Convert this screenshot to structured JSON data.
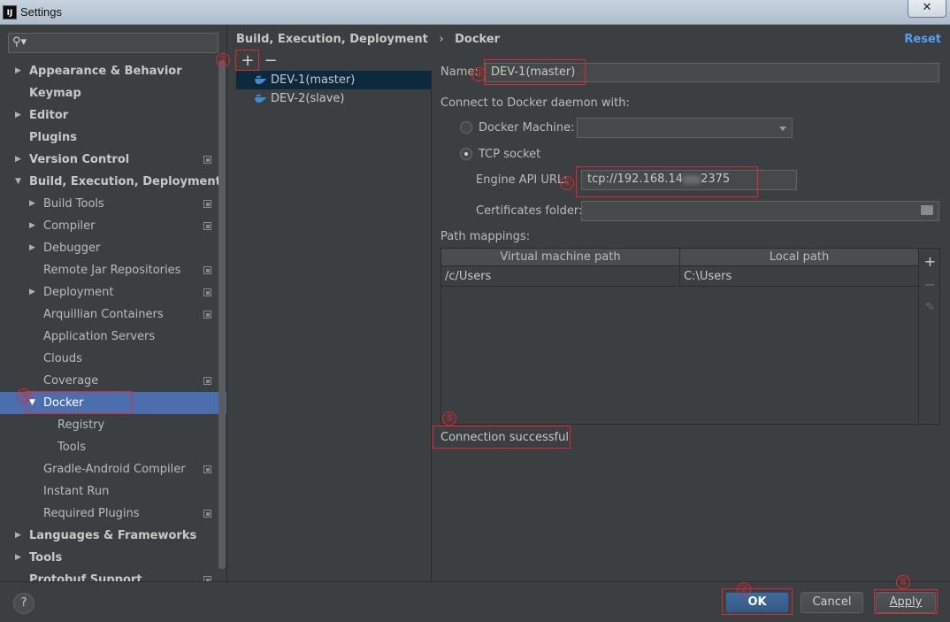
{
  "window": {
    "title": "Settings",
    "app_icon": "IJ",
    "close_icon": "✕"
  },
  "search": {
    "placeholder": "",
    "icon": "search-icon"
  },
  "tree": [
    {
      "label": "Appearance & Behavior",
      "level": 0,
      "bold": true,
      "expandable": true,
      "expanded": false,
      "project_icon": false
    },
    {
      "label": "Keymap",
      "level": 0,
      "bold": true,
      "expandable": false,
      "project_icon": false
    },
    {
      "label": "Editor",
      "level": 0,
      "bold": true,
      "expandable": true,
      "expanded": false,
      "project_icon": false
    },
    {
      "label": "Plugins",
      "level": 0,
      "bold": true,
      "expandable": false,
      "project_icon": false
    },
    {
      "label": "Version Control",
      "level": 0,
      "bold": true,
      "expandable": true,
      "expanded": false,
      "project_icon": true
    },
    {
      "label": "Build, Execution, Deployment",
      "level": 0,
      "bold": true,
      "expandable": true,
      "expanded": true,
      "project_icon": false
    },
    {
      "label": "Build Tools",
      "level": 1,
      "bold": false,
      "expandable": true,
      "expanded": false,
      "project_icon": true
    },
    {
      "label": "Compiler",
      "level": 1,
      "bold": false,
      "expandable": true,
      "expanded": false,
      "project_icon": true
    },
    {
      "label": "Debugger",
      "level": 1,
      "bold": false,
      "expandable": true,
      "expanded": false,
      "project_icon": false
    },
    {
      "label": "Remote Jar Repositories",
      "level": 1,
      "bold": false,
      "expandable": false,
      "project_icon": true
    },
    {
      "label": "Deployment",
      "level": 1,
      "bold": false,
      "expandable": true,
      "expanded": false,
      "project_icon": true
    },
    {
      "label": "Arquillian Containers",
      "level": 1,
      "bold": false,
      "expandable": false,
      "project_icon": true
    },
    {
      "label": "Application Servers",
      "level": 1,
      "bold": false,
      "expandable": false,
      "project_icon": false
    },
    {
      "label": "Clouds",
      "level": 1,
      "bold": false,
      "expandable": false,
      "project_icon": false
    },
    {
      "label": "Coverage",
      "level": 1,
      "bold": false,
      "expandable": false,
      "project_icon": true
    },
    {
      "label": "Docker",
      "level": 1,
      "bold": false,
      "expandable": true,
      "expanded": true,
      "project_icon": false,
      "selected": true
    },
    {
      "label": "Registry",
      "level": 2,
      "bold": false,
      "expandable": false,
      "project_icon": false
    },
    {
      "label": "Tools",
      "level": 2,
      "bold": false,
      "expandable": false,
      "project_icon": false
    },
    {
      "label": "Gradle-Android Compiler",
      "level": 1,
      "bold": false,
      "expandable": false,
      "project_icon": true
    },
    {
      "label": "Instant Run",
      "level": 1,
      "bold": false,
      "expandable": false,
      "project_icon": false
    },
    {
      "label": "Required Plugins",
      "level": 1,
      "bold": false,
      "expandable": false,
      "project_icon": true
    },
    {
      "label": "Languages & Frameworks",
      "level": 0,
      "bold": true,
      "expandable": true,
      "expanded": false,
      "project_icon": false
    },
    {
      "label": "Tools",
      "level": 0,
      "bold": true,
      "expandable": true,
      "expanded": false,
      "project_icon": false
    },
    {
      "label": "Protobuf Support",
      "level": 0,
      "bold": true,
      "expandable": false,
      "project_icon": true
    }
  ],
  "breadcrumb": {
    "parent": "Build, Execution, Deployment",
    "separator": "›",
    "current": "Docker"
  },
  "reset_label": "Reset",
  "toolbar": {
    "add": "+",
    "remove": "−"
  },
  "docker_configs": [
    {
      "name": "DEV-1(master)",
      "selected": true
    },
    {
      "name": "DEV-2(slave)",
      "selected": false
    }
  ],
  "form": {
    "name_label": "Name:",
    "name_value": "DEV-1(master)",
    "connect_label": "Connect to Docker daemon with:",
    "docker_machine_label": "Docker Machine:",
    "docker_machine_value": "",
    "tcp_label": "TCP socket",
    "engine_label": "Engine API URL:",
    "engine_value": "tcp://192.168.14",
    "engine_value_tail": "2375",
    "cert_label": "Certificates folder:",
    "cert_value": "",
    "path_label": "Path mappings:"
  },
  "path_table": {
    "columns": [
      "Virtual machine path",
      "Local path"
    ],
    "rows": [
      [
        "/c/Users",
        "C:\\Users"
      ]
    ],
    "side_buttons": {
      "add": "+",
      "remove": "−",
      "edit": "✎"
    }
  },
  "status": "Connection successful",
  "buttons": {
    "help": "?",
    "ok": "OK",
    "cancel": "Cancel",
    "apply": "Apply"
  },
  "annotations": [
    "①",
    "②",
    "③",
    "④",
    "⑤",
    "⑥",
    "⑦"
  ],
  "colors": {
    "accent": "#4b6eaf",
    "link": "#589df6",
    "annotation": "#e0282e",
    "background": "#3c3f41"
  }
}
